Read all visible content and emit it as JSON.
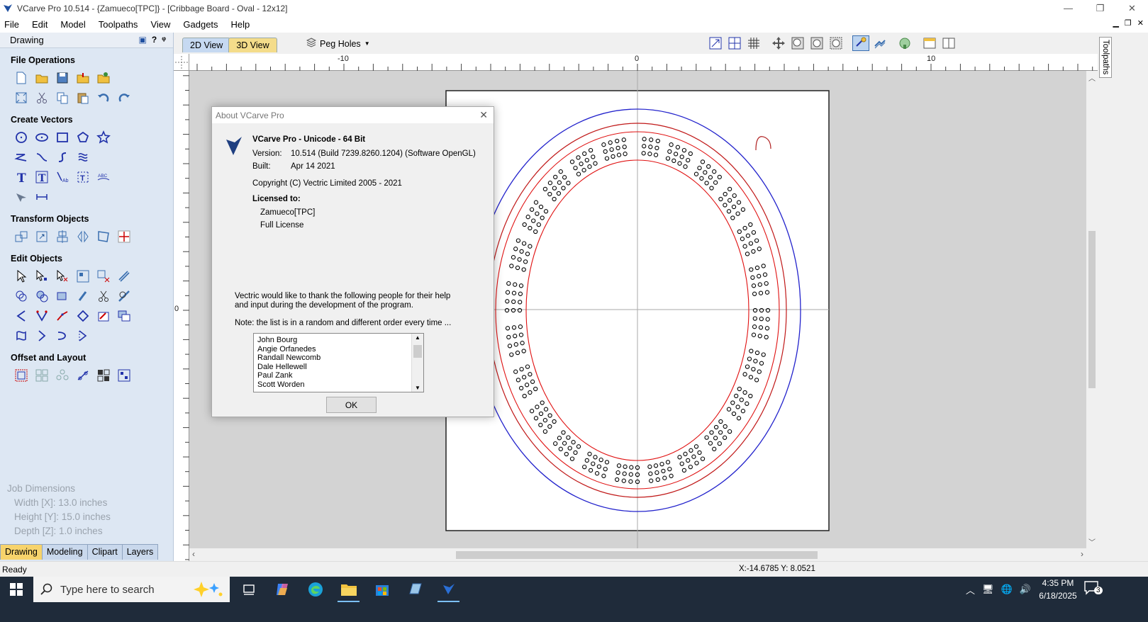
{
  "window": {
    "title": "VCarve Pro 10.514 - {Zamueco[TPC]} - [Cribbage Board - Oval - 12x12]",
    "controls": [
      "—",
      "❐",
      "✕"
    ]
  },
  "menu": {
    "items": [
      "File",
      "Edit",
      "Model",
      "Toolpaths",
      "View",
      "Gadgets",
      "Help"
    ],
    "mdi_controls": [
      "▁",
      "❐",
      "✕"
    ]
  },
  "left_panel": {
    "header": "Drawing",
    "header_icons": [
      "▣",
      "?",
      "ᵠ"
    ],
    "sections": [
      {
        "title": "File Operations"
      },
      {
        "title": "Create Vectors"
      },
      {
        "title": "Transform Objects"
      },
      {
        "title": "Edit Objects"
      },
      {
        "title": "Offset and Layout"
      }
    ],
    "job_dimensions": {
      "title": "Job Dimensions",
      "width": "Width  [X]: 13.0 inches",
      "height": "Height [Y]: 15.0 inches",
      "depth": "Depth  [Z]: 1.0 inches"
    },
    "bottom_tabs": [
      "Drawing",
      "Modeling",
      "Clipart",
      "Layers"
    ]
  },
  "view_toolbar": {
    "tabs": [
      "2D View",
      "3D View"
    ],
    "peg_holes": "Peg Holes"
  },
  "ruler": {
    "labels": [
      "-10",
      "0",
      "10"
    ],
    "vlabel": "0"
  },
  "side_tab": "Toolpaths",
  "status": {
    "ready": "Ready",
    "coords": "X:-14.6785 Y: 8.0521"
  },
  "taskbar": {
    "search_placeholder": "Type here to search",
    "time": "4:35 PM",
    "date": "6/18/2025",
    "notifications": "3"
  },
  "about_dialog": {
    "title": "About VCarve Pro",
    "product": "VCarve Pro - Unicode - 64 Bit",
    "version_label": "Version:",
    "version_value": "10.514  (Build 7239.8260.1204) (Software OpenGL)",
    "built_label": "Built:",
    "built_value": "Apr 14 2021",
    "copyright": "Copyright (C) Vectric Limited 2005 - 2021",
    "licensed_to_label": "Licensed to:",
    "licensee": "Zamueco[TPC]",
    "license_type": "Full License",
    "thanks_line1": "Vectric would like to thank the following people for their help",
    "thanks_line2": "and input during the development of the program.",
    "note": "Note: the list is in a random and different order every time ...",
    "names": [
      "John Bourg",
      "Angie Orfanedes",
      "Randall Newcomb",
      "Dale Hellewell",
      "Paul Zank",
      "Scott Worden"
    ],
    "ok_label": "OK"
  },
  "colors": {
    "outer_oval": "#2222cc",
    "inner_ovals": "#e01010",
    "peg_holes": "#000000"
  }
}
